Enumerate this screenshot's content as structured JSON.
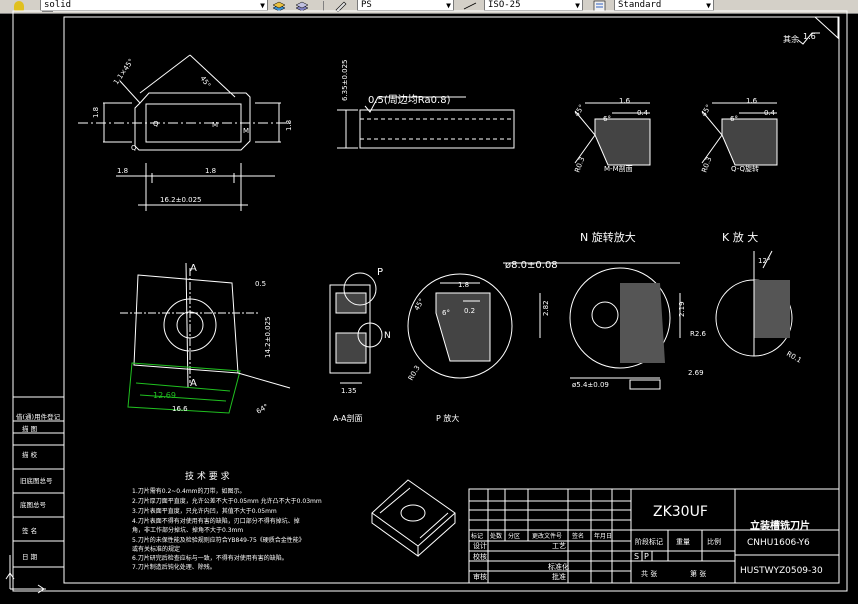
{
  "toolbar": {
    "linetype": "solid",
    "plot_style": "PS",
    "dim_style": "ISO-25",
    "text_style": "Standard"
  },
  "drawing": {
    "roughness_note": "其余",
    "roughness_value": "1.6",
    "top_view": {
      "angle_1": "1.1×45°",
      "angle_2": "45°",
      "left_dim": "1.8",
      "right_dim": "1.8",
      "bottom_left": "1.8",
      "bottom_right": "1.8",
      "width": "16.2±0.025",
      "label_q": "Q",
      "label_m": "M"
    },
    "side_view": {
      "thickness": "6.35±0.025",
      "surface_note": "0.5(周边均Ra0.8)"
    },
    "section_mm": {
      "dim_a": "1.6",
      "dim_b": "0.4",
      "angle_a": "45°",
      "angle_b": "6°",
      "radius": "R0.3",
      "caption": "M-M剖面"
    },
    "section_qq": {
      "dim_a": "1.6",
      "dim_b": "0.4",
      "angle_a": "45°",
      "angle_b": "6°",
      "radius": "R0.3",
      "caption": "Q-Q旋转"
    },
    "view_n": {
      "title": "N  旋转放大",
      "diameter": "ø8.0±0.08",
      "hole": "ø5.4±0.09",
      "dim_left": "2.82",
      "dim_right": "2.19",
      "dim_bottom": "2.69",
      "radius": "R2.6"
    },
    "view_k": {
      "title": "K  放 大",
      "angle": "12°",
      "radius": "R0.1"
    },
    "main_view": {
      "label_a_top": "A",
      "label_a_bottom": "A",
      "label_p": "P",
      "dim_top": "0.5",
      "dim_side": "14.2±0.025",
      "dim_bottom_1": "12.69",
      "dim_bottom_2": "16.6",
      "angle": "64°"
    },
    "section_aa": {
      "label_n": "N",
      "dim": "1.35",
      "caption": "A-A剖面"
    },
    "view_p": {
      "dim_a": "1.8",
      "dim_b": "0.2",
      "angle_a": "45°",
      "angle_b": "6°",
      "radius": "R0.3",
      "caption": "P   放大"
    },
    "tech": {
      "title": "技 术 要 求",
      "lines": [
        "1.刀片需有0.2~0.4mm的刀带，如图示。",
        "2.刀片厚刀面平直度，允许公差不大于0.05mm 允许凸不大于0.03mm",
        "3.刀片表面平直度，只允许内凹，其值不大于0.05mm",
        "4.刀片表面不得有对使用有害的缺陷，刃口部分不得有掉坑、掉",
        "  角，非工作部分掉坑、掉角不大于0.3mm",
        "5.刀片的未保性能及检验规则应符合YB849-75《硬质合金性能》",
        "  或有关标准的规定",
        "6.刀片研完后检查应标与一致，不得有对使用有害的缺陷。",
        "7.刀片制造后钝化处理、除残。"
      ]
    },
    "title_block": {
      "model": "ZK30UF",
      "name_line1": "立装槽铣刀片",
      "name_line2": "CNHU1606-Y6",
      "code": "HUSTWYZ0509-30",
      "h_mark": "标记",
      "h_count": "处数",
      "h_zone": "分区",
      "h_doc": "更改文件号",
      "h_sign": "签名",
      "h_date": "年月日",
      "r_design": "设计",
      "r_check": "校核",
      "r_review": "审核",
      "r_process": "工艺",
      "r_standard": "标准化",
      "r_approve": "批准",
      "stage_mark": "阶段标记",
      "weight": "重量",
      "scale": "比例",
      "s_letter": "S",
      "p_letter": "P",
      "total": "共  张",
      "sheet": "第  张"
    },
    "left_table": [
      "借(通)用件登记",
      "描  图",
      "描  校",
      "旧底图总号",
      "底图总号",
      "签  名",
      "日  期"
    ]
  }
}
